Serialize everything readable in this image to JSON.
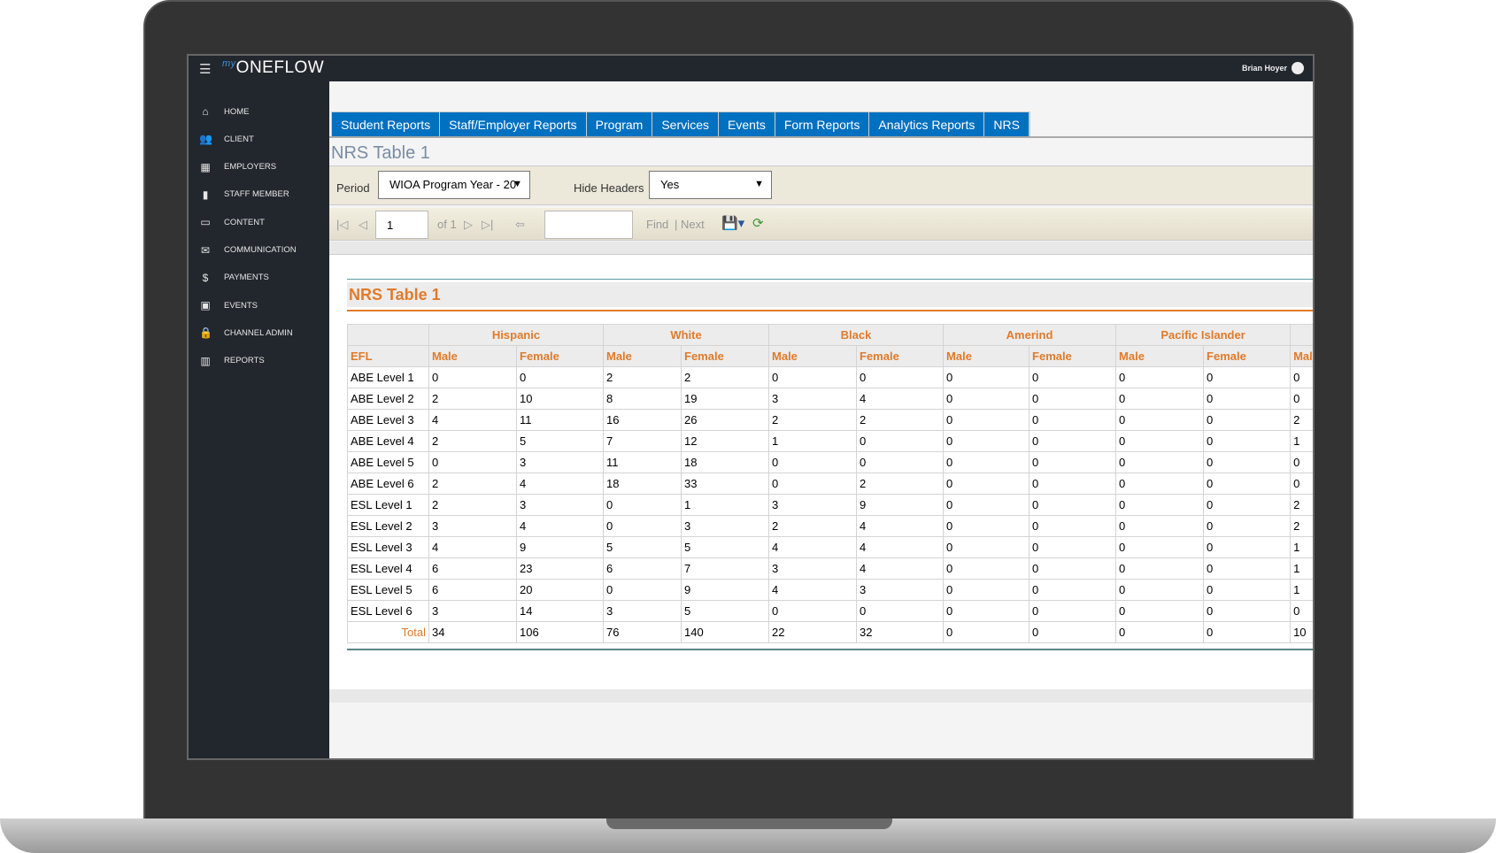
{
  "app": {
    "logo_prefix": "my",
    "logo": "ONEFLOW",
    "user": "Brian Hoyer"
  },
  "sidebar": {
    "items": [
      {
        "label": "HOME",
        "icon": "home-icon"
      },
      {
        "label": "CLIENT",
        "icon": "users-icon"
      },
      {
        "label": "EMPLOYERS",
        "icon": "building-icon"
      },
      {
        "label": "STAFF MEMBER",
        "icon": "bookmark-icon"
      },
      {
        "label": "CONTENT",
        "icon": "laptop-icon"
      },
      {
        "label": "COMMUNICATION",
        "icon": "mail-icon"
      },
      {
        "label": "PAYMENTS",
        "icon": "dollar-icon"
      },
      {
        "label": "EVENTS",
        "icon": "calendar-icon"
      },
      {
        "label": "CHANNEL ADMIN",
        "icon": "lock-icon"
      },
      {
        "label": "REPORTS",
        "icon": "chart-icon"
      }
    ]
  },
  "tabs": [
    "Student Reports",
    "Staff/Employer Reports",
    "Program",
    "Services",
    "Events",
    "Form Reports",
    "Analytics Reports",
    "NRS"
  ],
  "page_title": "NRS Table 1",
  "params": {
    "period_label": "Period",
    "period_value": "WIOA Program Year - 20",
    "hide_headers_label": "Hide Headers",
    "hide_headers_value": "Yes"
  },
  "toolbar": {
    "page": "1",
    "of": "of 1",
    "find": "Find",
    "sep": "|",
    "next": "Next"
  },
  "report": {
    "title": "NRS Table 1",
    "groups": [
      "Hispanic",
      "White",
      "Black",
      "Amerind",
      "Pacific Islander",
      ""
    ],
    "efl_header": "EFL",
    "male": "Male",
    "female": "Female",
    "total_label": "Total",
    "rows": [
      {
        "efl": "ABE Level 1",
        "v": [
          "0",
          "0",
          "2",
          "2",
          "0",
          "0",
          "0",
          "0",
          "0",
          "0",
          "0"
        ]
      },
      {
        "efl": "ABE Level 2",
        "v": [
          "2",
          "10",
          "8",
          "19",
          "3",
          "4",
          "0",
          "0",
          "0",
          "0",
          "0"
        ]
      },
      {
        "efl": "ABE Level 3",
        "v": [
          "4",
          "11",
          "16",
          "26",
          "2",
          "2",
          "0",
          "0",
          "0",
          "0",
          "2"
        ]
      },
      {
        "efl": "ABE Level 4",
        "v": [
          "2",
          "5",
          "7",
          "12",
          "1",
          "0",
          "0",
          "0",
          "0",
          "0",
          "1"
        ]
      },
      {
        "efl": "ABE Level 5",
        "v": [
          "0",
          "3",
          "11",
          "18",
          "0",
          "0",
          "0",
          "0",
          "0",
          "0",
          "0"
        ]
      },
      {
        "efl": "ABE Level 6",
        "v": [
          "2",
          "4",
          "18",
          "33",
          "0",
          "2",
          "0",
          "0",
          "0",
          "0",
          "0"
        ]
      },
      {
        "efl": "ESL Level 1",
        "v": [
          "2",
          "3",
          "0",
          "1",
          "3",
          "9",
          "0",
          "0",
          "0",
          "0",
          "2"
        ]
      },
      {
        "efl": "ESL Level 2",
        "v": [
          "3",
          "4",
          "0",
          "3",
          "2",
          "4",
          "0",
          "0",
          "0",
          "0",
          "2"
        ]
      },
      {
        "efl": "ESL Level 3",
        "v": [
          "4",
          "9",
          "5",
          "5",
          "4",
          "4",
          "0",
          "0",
          "0",
          "0",
          "1"
        ]
      },
      {
        "efl": "ESL Level 4",
        "v": [
          "6",
          "23",
          "6",
          "7",
          "3",
          "4",
          "0",
          "0",
          "0",
          "0",
          "1"
        ]
      },
      {
        "efl": "ESL Level 5",
        "v": [
          "6",
          "20",
          "0",
          "9",
          "4",
          "3",
          "0",
          "0",
          "0",
          "0",
          "1"
        ]
      },
      {
        "efl": "ESL Level 6",
        "v": [
          "3",
          "14",
          "3",
          "5",
          "0",
          "0",
          "0",
          "0",
          "0",
          "0",
          "0"
        ]
      }
    ],
    "totals": [
      "34",
      "106",
      "76",
      "140",
      "22",
      "32",
      "0",
      "0",
      "0",
      "0",
      "10"
    ]
  }
}
